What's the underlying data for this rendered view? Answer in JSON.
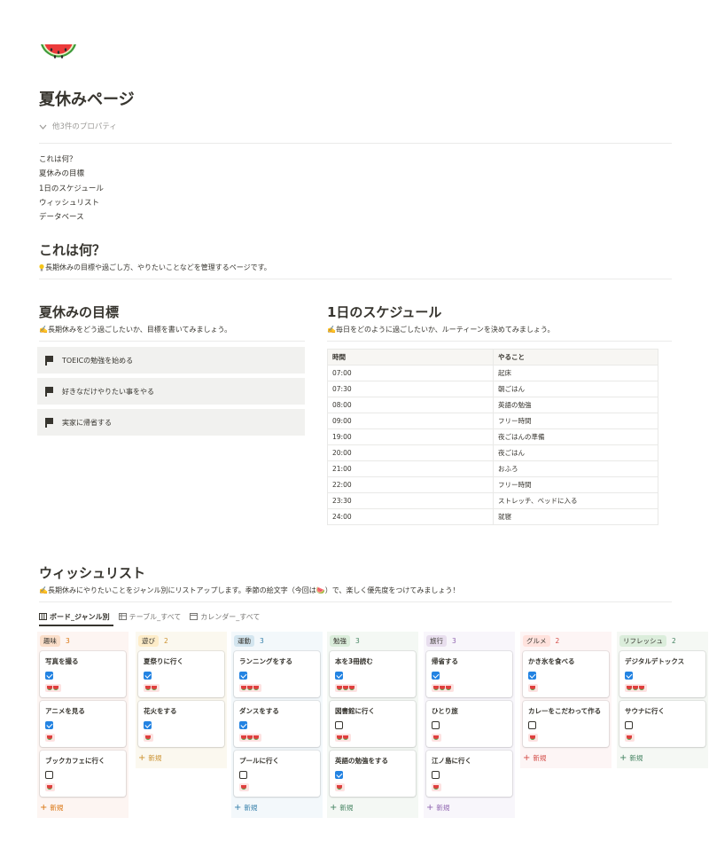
{
  "page": {
    "icon": "watermelon-icon",
    "title": "夏休みページ",
    "props_label": "他3件のプロパティ",
    "toc": [
      "これは何？",
      "夏休みの目標",
      "1日のスケジュール",
      "ウィッシュリスト",
      "データベース"
    ]
  },
  "about": {
    "heading": "これは何？",
    "description": "長期休みの目標や過ごし方、やりたいことなどを管理するページです。"
  },
  "goals": {
    "heading": "夏休みの目標",
    "description": "✍️長期休みをどう過ごしたいか、目標を書いてみましょう。",
    "items": [
      "TOEICの勉強を始める",
      "好きなだけやりたい事をやる",
      "実家に帰省する"
    ]
  },
  "schedule": {
    "heading": "1日のスケジュール",
    "description": "✍️毎日をどのように過ごしたいか、ルーティーンを決めてみましょう。",
    "headers": [
      "時間",
      "やること"
    ],
    "rows": [
      [
        "07:00",
        "起床"
      ],
      [
        "07:30",
        "朝ごはん"
      ],
      [
        "08:00",
        "英語の勉強"
      ],
      [
        "09:00",
        "フリー時間"
      ],
      [
        "19:00",
        "夜ごはんの準備"
      ],
      [
        "20:00",
        "夜ごはん"
      ],
      [
        "21:00",
        "おふろ"
      ],
      [
        "22:00",
        "フリー時間"
      ],
      [
        "23:30",
        "ストレッチ、ベッドに入る"
      ],
      [
        "24:00",
        "就寝"
      ]
    ]
  },
  "wishlist": {
    "heading": "ウィッシュリスト",
    "description": "✍️長期休みにやりたいことをジャンル別にリストアップします。季節の絵文字（今回は🍉）で、楽しく優先度をつけてみましょう！",
    "tabs": [
      "ボード_ジャンル別",
      "テーブル_すべて",
      "カレンダー_すべて"
    ],
    "new_label": "新規",
    "columns": [
      {
        "name": "趣味",
        "count": "3",
        "bg": "#fdf5f2",
        "pill": "#fadec9",
        "accent": "#d9730d",
        "cards": [
          {
            "title": "写真を撮る",
            "done": true,
            "prio": 2
          },
          {
            "title": "アニメを見る",
            "done": true,
            "prio": 1
          },
          {
            "title": "ブックカフェに行く",
            "done": false,
            "prio": 1
          }
        ]
      },
      {
        "name": "遊び",
        "count": "2",
        "bg": "#fbf8ef",
        "pill": "#fdecc8",
        "accent": "#cb912f",
        "cards": [
          {
            "title": "夏祭りに行く",
            "done": true,
            "prio": 2
          },
          {
            "title": "花火をする",
            "done": true,
            "prio": 1
          }
        ]
      },
      {
        "name": "運動",
        "count": "3",
        "bg": "#f3f8fb",
        "pill": "#d3e5ef",
        "accent": "#337ea9",
        "cards": [
          {
            "title": "ランニングをする",
            "done": true,
            "prio": 3
          },
          {
            "title": "ダンスをする",
            "done": true,
            "prio": 3
          },
          {
            "title": "プールに行く",
            "done": false,
            "prio": 1
          }
        ]
      },
      {
        "name": "勉強",
        "count": "3",
        "bg": "#f4f8f4",
        "pill": "#dbeddb",
        "accent": "#448361",
        "cards": [
          {
            "title": "本を3冊読む",
            "done": true,
            "prio": 3
          },
          {
            "title": "図書館に行く",
            "done": false,
            "prio": 2
          },
          {
            "title": "英語の勉強をする",
            "done": true,
            "prio": 1
          }
        ]
      },
      {
        "name": "旅行",
        "count": "3",
        "bg": "#f8f6fb",
        "pill": "#e8deee",
        "accent": "#9065b0",
        "cards": [
          {
            "title": "帰省する",
            "done": true,
            "prio": 3
          },
          {
            "title": "ひとり旅",
            "done": false,
            "prio": 1
          },
          {
            "title": "江ノ島に行く",
            "done": false,
            "prio": 1
          }
        ]
      },
      {
        "name": "グルメ",
        "count": "2",
        "bg": "#fdf5f5",
        "pill": "#ffe2dd",
        "accent": "#d44c47",
        "cards": [
          {
            "title": "かき氷を食べる",
            "done": true,
            "prio": 1
          },
          {
            "title": "カレーをこだわって作る",
            "done": false,
            "prio": 1
          }
        ]
      },
      {
        "name": "リフレッシュ",
        "count": "2",
        "bg": "#f5f8f4",
        "pill": "#dbeddb",
        "accent": "#448361",
        "cards": [
          {
            "title": "デジタルデトックス",
            "done": true,
            "prio": 3
          },
          {
            "title": "サウナに行く",
            "done": false,
            "prio": 1
          }
        ]
      }
    ]
  }
}
